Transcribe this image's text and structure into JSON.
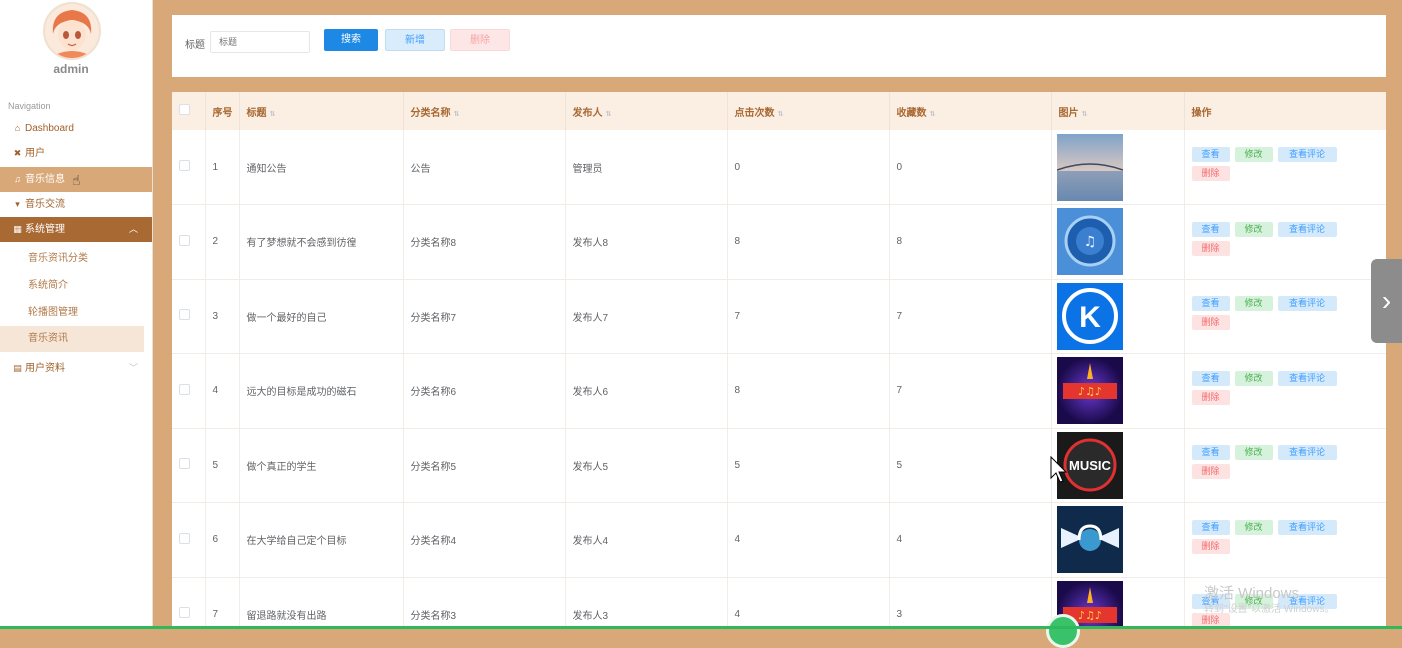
{
  "sidebar": {
    "username": "admin",
    "nav_caption": "Navigation",
    "items": [
      {
        "label": "Dashboard",
        "icon": "home-icon"
      },
      {
        "label": "用户",
        "icon": "users-icon"
      },
      {
        "label": "音乐信息",
        "icon": "music-icon"
      },
      {
        "label": "音乐交流",
        "icon": "chat-icon"
      },
      {
        "label": "系统管理",
        "icon": "grid-icon"
      },
      {
        "label": "用户资料",
        "icon": "profile-icon"
      }
    ],
    "system_sub_items": [
      "音乐资讯分类",
      "系统简介",
      "轮播图管理",
      "音乐资讯"
    ]
  },
  "search": {
    "label": "标题",
    "placeholder": "标题",
    "search_button": "搜索",
    "add_button": "新增",
    "delete_button": "删除"
  },
  "table": {
    "columns": [
      "序号",
      "标题",
      "分类名称",
      "发布人",
      "点击次数",
      "收藏数",
      "图片",
      "操作"
    ],
    "actions": {
      "view": "查看",
      "edit": "修改",
      "comments": "查看评论",
      "delete": "删除"
    },
    "rows": [
      {
        "no": "1",
        "title": "通知公告",
        "category": "公告",
        "publisher": "管理员",
        "clicks": "0",
        "favorites": "0",
        "image": "bridge-sunset-image"
      },
      {
        "no": "2",
        "title": "有了梦想就不会感到彷徨",
        "category": "分类名称8",
        "publisher": "发布人8",
        "clicks": "8",
        "favorites": "8",
        "image": "blue-music-app-image"
      },
      {
        "no": "3",
        "title": "做一个最好的自己",
        "category": "分类名称7",
        "publisher": "发布人7",
        "clicks": "7",
        "favorites": "7",
        "image": "kugou-k-logo-image"
      },
      {
        "no": "4",
        "title": "远大的目标是成功的磁石",
        "category": "分类名称6",
        "publisher": "发布人6",
        "clicks": "8",
        "favorites": "7",
        "image": "music-poster-image"
      },
      {
        "no": "5",
        "title": "做个真正的学生",
        "category": "分类名称5",
        "publisher": "发布人5",
        "clicks": "5",
        "favorites": "5",
        "image": "music-badge-image"
      },
      {
        "no": "6",
        "title": "在大学给自己定个目标",
        "category": "分类名称4",
        "publisher": "发布人4",
        "clicks": "4",
        "favorites": "4",
        "image": "winged-headphones-image"
      },
      {
        "no": "7",
        "title": "留退路就没有出路",
        "category": "分类名称3",
        "publisher": "发布人3",
        "clicks": "4",
        "favorites": "3",
        "image": "music-poster-image"
      }
    ]
  },
  "overlay": {
    "watermark_title": "激活 Windows",
    "watermark_sub": "转到\"设置\"以激活 Windows。",
    "side_arrow": "›"
  },
  "colors": {
    "background": "#d9a878",
    "accent": "#a86933",
    "primary": "#1e88e5"
  }
}
